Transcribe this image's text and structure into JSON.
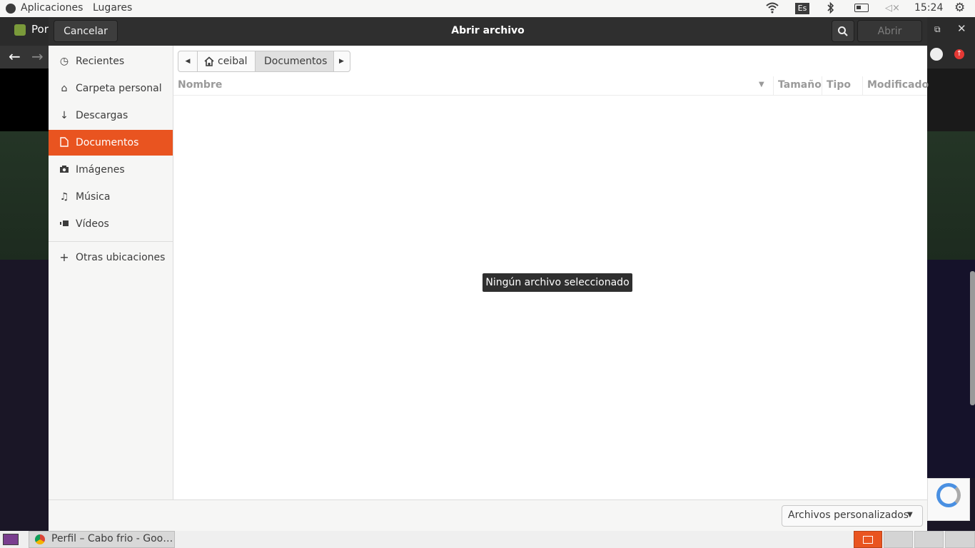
{
  "top_panel": {
    "applications": "Aplicaciones",
    "places": "Lugares",
    "keyboard_layout": "Es",
    "clock": "15:24"
  },
  "background_app": {
    "title_fragment": "Por"
  },
  "dialog": {
    "title": "Abrir archivo",
    "cancel_label": "Cancelar",
    "open_label": "Abrir",
    "path": {
      "home_label": "ceibal",
      "current_label": "Documentos"
    },
    "columns": {
      "name": "Nombre",
      "size": "Tamaño",
      "type": "Tipo",
      "modified": "Modificado"
    },
    "empty_message": "Ningún archivo seleccionado",
    "filter_label": "Archivos personalizados"
  },
  "sidebar": {
    "items": [
      {
        "label": "Recientes",
        "icon": "clock-icon"
      },
      {
        "label": "Carpeta personal",
        "icon": "home-icon"
      },
      {
        "label": "Descargas",
        "icon": "download-icon"
      },
      {
        "label": "Documentos",
        "icon": "document-icon",
        "active": true
      },
      {
        "label": "Imágenes",
        "icon": "camera-icon"
      },
      {
        "label": "Música",
        "icon": "music-icon"
      },
      {
        "label": "Vídeos",
        "icon": "video-icon"
      }
    ],
    "other_locations": "Otras ubicaciones"
  },
  "taskbar": {
    "window_label": "Perfil – Cabo frio - Goo…"
  },
  "colors": {
    "accent": "#e95420",
    "header_bg": "#2f2f2f"
  }
}
